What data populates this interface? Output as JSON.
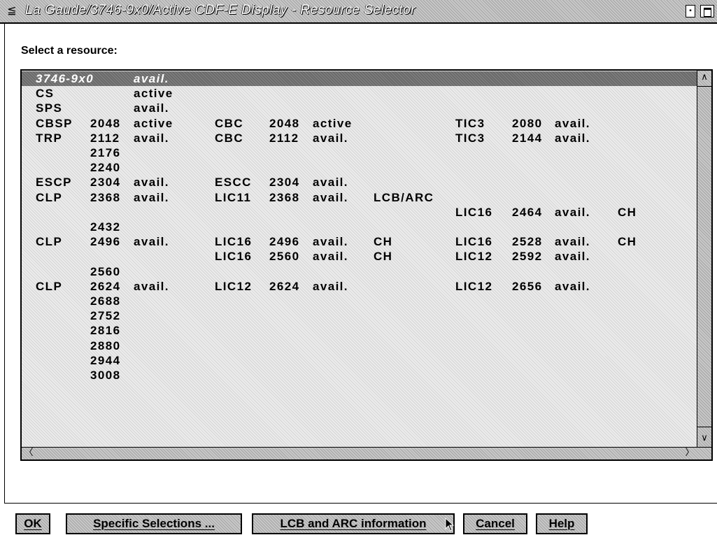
{
  "window": {
    "title": "La Gaude/3746-9x0/Active CDF-E Display - Resource Selector",
    "sysmenu_icon": "system-menu-icon",
    "min_icon": "minimize-icon",
    "max_icon": "maximize-icon"
  },
  "prompt": "Select a resource:",
  "list": {
    "columns": [
      "name",
      "addr",
      "status",
      "name2",
      "addr2",
      "status2",
      "extra2",
      "name3",
      "addr3",
      "status3",
      "extra3"
    ],
    "rows": [
      {
        "c1": "3746-9x0",
        "c2": "",
        "c3": "avail.",
        "selected": true
      },
      {
        "c1": "CS",
        "c2": "",
        "c3": "active"
      },
      {
        "c1": "SPS",
        "c2": "",
        "c3": "avail."
      },
      {
        "c1": "CBSP",
        "c2": "2048",
        "c3": "active",
        "c4": "CBC",
        "c5": "2048",
        "c6": "active",
        "c8": "TIC3",
        "c9": "2080",
        "c10": "avail."
      },
      {
        "c1": "TRP",
        "c2": "2112",
        "c3": "avail.",
        "c4": "CBC",
        "c5": "2112",
        "c6": "avail.",
        "c8": "TIC3",
        "c9": "2144",
        "c10": "avail."
      },
      {
        "c1": "",
        "c2": "2176"
      },
      {
        "c1": "",
        "c2": "2240"
      },
      {
        "c1": "ESCP",
        "c2": "2304",
        "c3": "avail.",
        "c4": "ESCC",
        "c5": "2304",
        "c6": "avail."
      },
      {
        "c1": "CLP",
        "c2": "2368",
        "c3": "avail.",
        "c4": "LIC11",
        "c5": "2368",
        "c6": "avail.",
        "c7": "LCB/ARC"
      },
      {
        "c8": "LIC16",
        "c9": "2464",
        "c10": "avail.",
        "c11": "CH"
      },
      {
        "c1": "",
        "c2": "2432"
      },
      {
        "c1": "CLP",
        "c2": "2496",
        "c3": "avail.",
        "c4": "LIC16",
        "c5": "2496",
        "c6": "avail.",
        "c7": "CH",
        "c8": "LIC16",
        "c9": "2528",
        "c10": "avail.",
        "c11": "CH"
      },
      {
        "c4": "LIC16",
        "c5": "2560",
        "c6": "avail.",
        "c7": "CH",
        "c8": "LIC12",
        "c9": "2592",
        "c10": "avail."
      },
      {
        "c1": "",
        "c2": "2560"
      },
      {
        "c1": "CLP",
        "c2": "2624",
        "c3": "avail.",
        "c4": "LIC12",
        "c5": "2624",
        "c6": "avail.",
        "c8": "LIC12",
        "c9": "2656",
        "c10": "avail."
      },
      {
        "c2": "2688"
      },
      {
        "c2": "2752"
      },
      {
        "c2": "2816"
      },
      {
        "c2": "2880"
      },
      {
        "c2": "2944"
      },
      {
        "c2": "3008"
      }
    ]
  },
  "buttons": [
    {
      "id": "ok",
      "label": "OK"
    },
    {
      "id": "specific",
      "label": "Specific Selections ..."
    },
    {
      "id": "lcb",
      "label": "LCB and ARC information"
    },
    {
      "id": "cancel",
      "label": "Cancel"
    },
    {
      "id": "help",
      "label": "Help"
    }
  ],
  "colors": {
    "selection": "#6a6a6a",
    "background": "#c8c8c8"
  }
}
